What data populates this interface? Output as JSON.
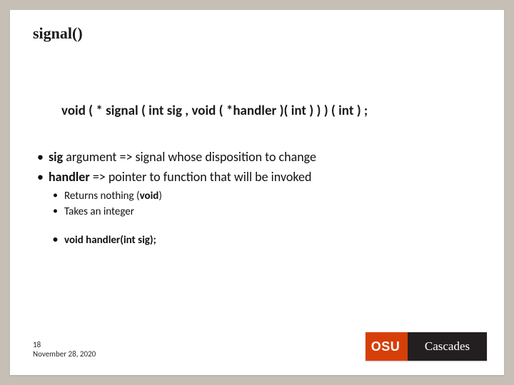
{
  "title": "signal()",
  "prototype": "void ( * signal ( int sig , void ( *handler )( int ) ) ) ( int ) ;",
  "bullets": {
    "b1_bold": "sig",
    "b1_rest": " argument => signal whose disposition to change",
    "b2_bold": "handler",
    "b2_rest": " => pointer to function that will be invoked",
    "b2_1a": "Returns nothing (",
    "b2_1b": "void",
    "b2_1c": ")",
    "b2_2": "Takes an integer",
    "b3": "void handler(int sig);"
  },
  "footer": {
    "page": "18",
    "date": "November 28, 2020"
  },
  "logo": {
    "osu": "OSU",
    "cascades": "Cascades"
  }
}
